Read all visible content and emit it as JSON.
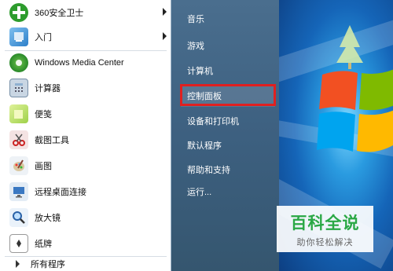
{
  "colors": {
    "menu_right": "#3d6080",
    "menu_left": "#ffffff",
    "highlight_border": "#e02020",
    "watermark_green": "#2aa845"
  },
  "left_programs": [
    {
      "label": "360安全卫士",
      "icon": "360-shield-icon",
      "has_submenu": true
    },
    {
      "label": "入门",
      "icon": "getting-started-icon",
      "has_submenu": true
    },
    {
      "label": "Windows Media Center",
      "icon": "media-center-icon",
      "has_submenu": false
    },
    {
      "label": "计算器",
      "icon": "calculator-icon",
      "has_submenu": false
    },
    {
      "label": "便笺",
      "icon": "sticky-notes-icon",
      "has_submenu": false
    },
    {
      "label": "截图工具",
      "icon": "snipping-tool-icon",
      "has_submenu": false
    },
    {
      "label": "画图",
      "icon": "paint-icon",
      "has_submenu": false
    },
    {
      "label": "远程桌面连接",
      "icon": "remote-desktop-icon",
      "has_submenu": false
    },
    {
      "label": "放大镜",
      "icon": "magnifier-icon",
      "has_submenu": false
    },
    {
      "label": "纸牌",
      "icon": "solitaire-icon",
      "has_submenu": false
    }
  ],
  "all_programs_label": "所有程序",
  "right_items": [
    {
      "label": "音乐"
    },
    {
      "label": "游戏"
    },
    {
      "label": "计算机"
    },
    {
      "label": "控制面板",
      "highlighted": true
    },
    {
      "label": "设备和打印机"
    },
    {
      "label": "默认程序"
    },
    {
      "label": "帮助和支持"
    },
    {
      "label": "运行..."
    }
  ],
  "watermark": {
    "title": "百科全说",
    "subtitle": "助你轻松解决"
  }
}
